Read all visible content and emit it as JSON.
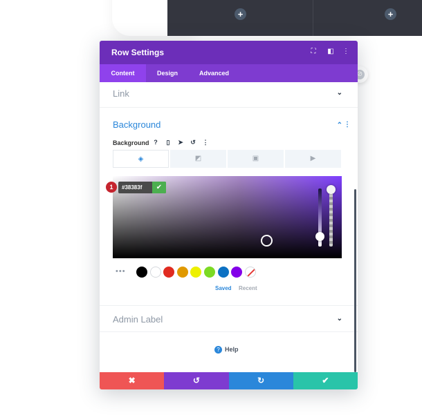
{
  "canvas": {
    "plus_glyph": "+",
    "float_glyph": "⊘"
  },
  "modal": {
    "title": "Row Settings",
    "header_icons": {
      "expand": "⛶",
      "columns": "◧",
      "more": "⋮"
    },
    "tabs": [
      {
        "label": "Content",
        "active": true
      },
      {
        "label": "Design",
        "active": false
      },
      {
        "label": "Advanced",
        "active": false
      }
    ],
    "sections": {
      "link": {
        "title": "Link",
        "chevron": "⌄"
      },
      "background": {
        "title": "Background",
        "chevron": "⌃",
        "more": "⋮"
      },
      "admin_label": {
        "title": "Admin Label",
        "chevron": "⌄"
      }
    },
    "background_field": {
      "label": "Background",
      "icons": {
        "help": "?",
        "mobile": "▯",
        "pointer": "➤",
        "undo": "↺",
        "more": "⋮"
      },
      "type_tabs": [
        {
          "name": "color",
          "glyph": "◈",
          "active": true
        },
        {
          "name": "gradient",
          "glyph": "◩",
          "active": false
        },
        {
          "name": "image",
          "glyph": "▣",
          "active": false
        },
        {
          "name": "video",
          "glyph": "▶",
          "active": false
        }
      ]
    },
    "color_picker": {
      "hex_value": "#38383f",
      "confirm_glyph": "✔",
      "step_badge": "1",
      "swatches_more": "•••",
      "swatches": [
        "#000000",
        "#ffffff",
        "#e02b20",
        "#e09900",
        "#edf000",
        "#7cda24",
        "#0c71c3",
        "#8300e9",
        "none"
      ],
      "saved_label": "Saved",
      "recent_label": "Recent"
    },
    "help_label": "Help",
    "help_glyph": "?",
    "footer": [
      {
        "name": "discard",
        "glyph": "✖",
        "color": "#ef5555"
      },
      {
        "name": "undo",
        "glyph": "↺",
        "color": "#7e3bd0"
      },
      {
        "name": "redo",
        "glyph": "↻",
        "color": "#2b87da"
      },
      {
        "name": "save",
        "glyph": "✔",
        "color": "#29c4a9"
      }
    ]
  }
}
